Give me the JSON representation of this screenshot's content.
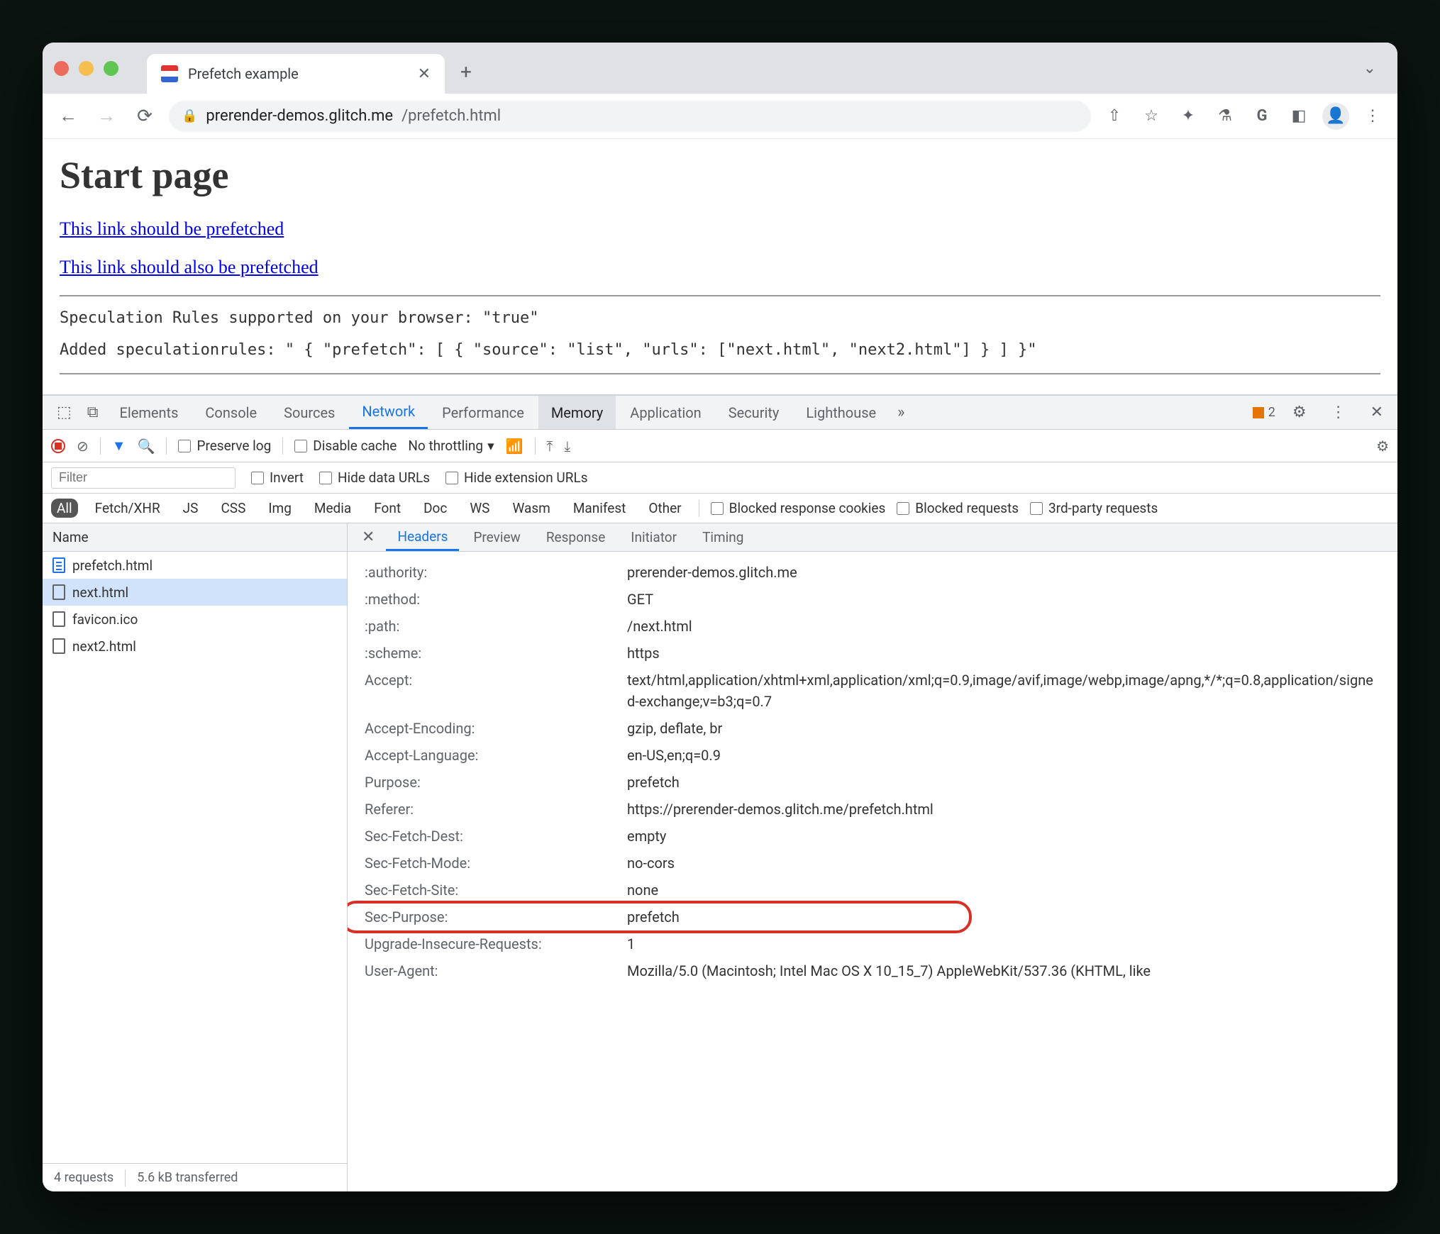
{
  "browser": {
    "tab_title": "Prefetch example",
    "url_host": "prerender-demos.glitch.me",
    "url_path": "/prefetch.html"
  },
  "page": {
    "heading": "Start page",
    "link1": "This link should be prefetched",
    "link2": "This link should also be prefetched",
    "support_line": "Speculation Rules supported on your browser: \"true\"",
    "rules_line": "Added speculationrules: \" { \"prefetch\": [ { \"source\": \"list\", \"urls\": [\"next.html\", \"next2.html\"] } ] }\""
  },
  "devtools": {
    "panels": [
      "Elements",
      "Console",
      "Sources",
      "Network",
      "Performance",
      "Memory",
      "Application",
      "Security",
      "Lighthouse"
    ],
    "active_panel": "Network",
    "highlighted_panel": "Memory",
    "warning_count": "2",
    "toolbar": {
      "preserve_log": "Preserve log",
      "disable_cache": "Disable cache",
      "throttling": "No throttling"
    },
    "filter": {
      "placeholder": "Filter",
      "invert": "Invert",
      "hide_data": "Hide data URLs",
      "hide_ext": "Hide extension URLs"
    },
    "types": [
      "All",
      "Fetch/XHR",
      "JS",
      "CSS",
      "Img",
      "Media",
      "Font",
      "Doc",
      "WS",
      "Wasm",
      "Manifest",
      "Other"
    ],
    "type_checks": {
      "blocked_cookies": "Blocked response cookies",
      "blocked_requests": "Blocked requests",
      "third_party": "3rd-party requests"
    },
    "requests": {
      "header": "Name",
      "items": [
        {
          "name": "prefetch.html",
          "type": "doc"
        },
        {
          "name": "next.html",
          "type": "outline",
          "selected": true
        },
        {
          "name": "favicon.ico",
          "type": "outline"
        },
        {
          "name": "next2.html",
          "type": "outline"
        }
      ],
      "summary_count": "4 requests",
      "summary_size": "5.6 kB transferred"
    },
    "detail": {
      "tabs": [
        "Headers",
        "Preview",
        "Response",
        "Initiator",
        "Timing"
      ],
      "active": "Headers",
      "headers": [
        {
          "name": ":authority:",
          "value": "prerender-demos.glitch.me"
        },
        {
          "name": ":method:",
          "value": "GET"
        },
        {
          "name": ":path:",
          "value": "/next.html"
        },
        {
          "name": ":scheme:",
          "value": "https"
        },
        {
          "name": "Accept:",
          "value": "text/html,application/xhtml+xml,application/xml;q=0.9,image/avif,image/webp,image/apng,*/*;q=0.8,application/signed-exchange;v=b3;q=0.7"
        },
        {
          "name": "Accept-Encoding:",
          "value": "gzip, deflate, br"
        },
        {
          "name": "Accept-Language:",
          "value": "en-US,en;q=0.9"
        },
        {
          "name": "Purpose:",
          "value": "prefetch"
        },
        {
          "name": "Referer:",
          "value": "https://prerender-demos.glitch.me/prefetch.html"
        },
        {
          "name": "Sec-Fetch-Dest:",
          "value": "empty"
        },
        {
          "name": "Sec-Fetch-Mode:",
          "value": "no-cors"
        },
        {
          "name": "Sec-Fetch-Site:",
          "value": "none"
        },
        {
          "name": "Sec-Purpose:",
          "value": "prefetch",
          "highlight": true
        },
        {
          "name": "Upgrade-Insecure-Requests:",
          "value": "1"
        },
        {
          "name": "User-Agent:",
          "value": "Mozilla/5.0 (Macintosh; Intel Mac OS X 10_15_7) AppleWebKit/537.36 (KHTML, like"
        }
      ]
    }
  }
}
